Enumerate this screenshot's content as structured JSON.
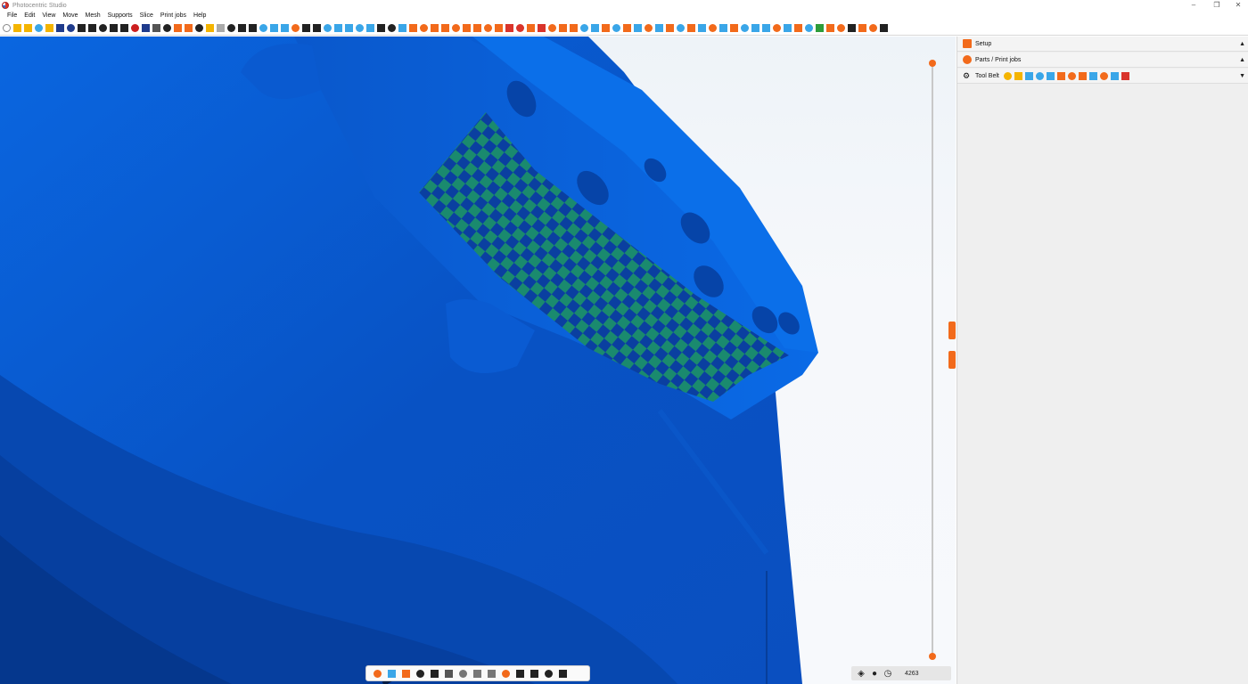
{
  "window": {
    "title": "Photocentric Studio",
    "controls": [
      "–",
      "❐",
      "✕"
    ]
  },
  "menu": [
    "File",
    "Edit",
    "View",
    "Move",
    "Mesh",
    "Supports",
    "Slice",
    "Print jobs",
    "Help"
  ],
  "toolbar": {
    "icons": [
      {
        "name": "new-file-icon",
        "color": "#ffffff"
      },
      {
        "name": "open-folder-icon",
        "color": "#f4b400"
      },
      {
        "name": "add-part-icon",
        "color": "#f4b400"
      },
      {
        "name": "import-icon",
        "color": "#3aa6e8"
      },
      {
        "name": "folder-icon",
        "color": "#f4b400"
      },
      {
        "name": "save-icon",
        "color": "#1f3b8c"
      },
      {
        "name": "save-all-icon",
        "color": "#1f3b8c"
      },
      {
        "name": "printer-icon",
        "color": "#222222"
      },
      {
        "name": "settings-icon",
        "color": "#222222"
      },
      {
        "name": "export-icon",
        "color": "#222222"
      },
      {
        "name": "share-icon",
        "color": "#222222"
      },
      {
        "name": "key-icon",
        "color": "#222222"
      },
      {
        "name": "delete-icon",
        "color": "#cc1f1f"
      },
      {
        "name": "undo-icon",
        "color": "#1f3b8c"
      },
      {
        "name": "redo-icon",
        "color": "#555555"
      },
      {
        "name": "copy-icon",
        "color": "#222222"
      },
      {
        "name": "paste-icon",
        "color": "#f26a1b"
      },
      {
        "name": "basket-icon",
        "color": "#f26a1b"
      },
      {
        "name": "trash-icon",
        "color": "#222222"
      },
      {
        "name": "select-all-icon",
        "color": "#f4b400"
      },
      {
        "name": "select-icon",
        "color": "#aaaaaa"
      },
      {
        "name": "info-icon",
        "color": "#222222"
      },
      {
        "name": "zoom-icon",
        "color": "#222222"
      },
      {
        "name": "pen-icon",
        "color": "#222222"
      },
      {
        "name": "rotate-x-icon",
        "color": "#3aa6e8"
      },
      {
        "name": "rotate-y-icon",
        "color": "#3aa6e8"
      },
      {
        "name": "rotate-z-icon",
        "color": "#3aa6e8"
      },
      {
        "name": "scale-icon",
        "color": "#f26a1b"
      },
      {
        "name": "frame-icon",
        "color": "#222222"
      },
      {
        "name": "line-icon",
        "color": "#222222"
      },
      {
        "name": "measure-icon",
        "color": "#3aa6e8"
      },
      {
        "name": "arrange-icon",
        "color": "#3aa6e8"
      },
      {
        "name": "snowflake-icon",
        "color": "#3aa6e8"
      },
      {
        "name": "mirror-icon",
        "color": "#3aa6e8"
      },
      {
        "name": "grid-icon",
        "color": "#3aa6e8"
      },
      {
        "name": "hollow-icon",
        "color": "#222222"
      },
      {
        "name": "split-icon",
        "color": "#222222"
      },
      {
        "name": "cube-icon",
        "color": "#3aa6e8"
      },
      {
        "name": "links-icon",
        "color": "#f26a1b"
      },
      {
        "name": "bolt-icon",
        "color": "#f26a1b"
      },
      {
        "name": "ring-icon",
        "color": "#f26a1b"
      },
      {
        "name": "target-icon",
        "color": "#f26a1b"
      },
      {
        "name": "gear-orange-icon",
        "color": "#f26a1b"
      },
      {
        "name": "donut-icon",
        "color": "#f26a1b"
      },
      {
        "name": "cup-icon",
        "color": "#f26a1b"
      },
      {
        "name": "globe-icon",
        "color": "#f26a1b"
      },
      {
        "name": "sphere-icon",
        "color": "#f26a1b"
      },
      {
        "name": "support-icon",
        "color": "#d9342b"
      },
      {
        "name": "cubes-icon",
        "color": "#d9342b"
      },
      {
        "name": "paint-icon",
        "color": "#f26a1b"
      },
      {
        "name": "grid-support-icon",
        "color": "#d9342b"
      },
      {
        "name": "drop-icon",
        "color": "#f26a1b"
      },
      {
        "name": "base-icon",
        "color": "#f26a1b"
      },
      {
        "name": "text-icon",
        "color": "#f26a1b"
      },
      {
        "name": "slice-a-icon",
        "color": "#3aa6e8"
      },
      {
        "name": "slice-b-icon",
        "color": "#3aa6e8"
      },
      {
        "name": "slice-c-icon",
        "color": "#f26a1b"
      },
      {
        "name": "slice-d-icon",
        "color": "#3aa6e8"
      },
      {
        "name": "slice-e-icon",
        "color": "#f26a1b"
      },
      {
        "name": "slice-f-icon",
        "color": "#3aa6e8"
      },
      {
        "name": "slice-g-icon",
        "color": "#f26a1b"
      },
      {
        "name": "slice-h-icon",
        "color": "#3aa6e8"
      },
      {
        "name": "slice-i-icon",
        "color": "#f26a1b"
      },
      {
        "name": "slice-j-icon",
        "color": "#3aa6e8"
      },
      {
        "name": "slice-k-icon",
        "color": "#f26a1b"
      },
      {
        "name": "slice-l-icon",
        "color": "#3aa6e8"
      },
      {
        "name": "slice-m-icon",
        "color": "#f26a1b"
      },
      {
        "name": "slice-n-icon",
        "color": "#3aa6e8"
      },
      {
        "name": "drop2-icon",
        "color": "#f26a1b"
      },
      {
        "name": "cloud-icon",
        "color": "#3aa6e8"
      },
      {
        "name": "bridge-icon",
        "color": "#3aa6e8"
      },
      {
        "name": "arch-icon",
        "color": "#3aa6e8"
      },
      {
        "name": "brush-icon",
        "color": "#f26a1b"
      },
      {
        "name": "tree-icon",
        "color": "#3aa6e8"
      },
      {
        "name": "branch-icon",
        "color": "#f26a1b"
      },
      {
        "name": "plant-icon",
        "color": "#3aa6e8"
      },
      {
        "name": "leaf-icon",
        "color": "#2e9c3a"
      },
      {
        "name": "print-icon",
        "color": "#f26a1b"
      },
      {
        "name": "flag-icon",
        "color": "#f26a1b"
      },
      {
        "name": "http-icon",
        "color": "#222222"
      },
      {
        "name": "link-out-icon",
        "color": "#f26a1b"
      },
      {
        "name": "external-icon",
        "color": "#f26a1b"
      },
      {
        "name": "upload-icon",
        "color": "#222222"
      }
    ]
  },
  "viewport": {
    "colors": {
      "model": "#0a5fd6",
      "model_dark": "#003c9c",
      "checker_a": "#1a8a6e",
      "checker_b": "#0a3fa0"
    }
  },
  "bottom_toolbar": {
    "icons": [
      {
        "name": "box-icon",
        "color": "#f26a1b"
      },
      {
        "name": "funnel-icon",
        "color": "#3aa6e8"
      },
      {
        "name": "circle-icon",
        "color": "#f26a1b"
      },
      {
        "name": "grid-view-icon",
        "color": "#222222"
      },
      {
        "name": "disk-icon",
        "color": "#222222"
      },
      {
        "name": "contrast-icon",
        "color": "#555555"
      },
      {
        "name": "bowl-icon",
        "color": "#777777"
      },
      {
        "name": "minus-icon",
        "color": "#777777"
      },
      {
        "name": "drop-down-icon",
        "color": "#777777"
      },
      {
        "name": "palette-icon",
        "color": "#f26a1b"
      },
      {
        "name": "ruler-icon",
        "color": "#222222"
      },
      {
        "name": "checker-icon",
        "color": "#222222"
      },
      {
        "name": "table-icon",
        "color": "#222222"
      },
      {
        "name": "swap-icon",
        "color": "#222222"
      }
    ]
  },
  "status": {
    "layers_icon": "layers-icon",
    "drop_icon": "resin-icon",
    "clock_icon": "clock-icon",
    "layer_count": "4263"
  },
  "right_panel": {
    "setup": {
      "label": "Setup",
      "caret": "▲"
    },
    "parts": {
      "label": "Parts / Print jobs",
      "caret": "▲"
    },
    "toolbelt": {
      "label": "Tool Belt",
      "caret": "▼",
      "icons": [
        {
          "name": "clock-tool-icon",
          "color": "#f4b400"
        },
        {
          "name": "folder-tool-icon",
          "color": "#f4b400"
        },
        {
          "name": "layout-tool-icon",
          "color": "#3aa6e8"
        },
        {
          "name": "arch-tool-icon",
          "color": "#3aa6e8"
        },
        {
          "name": "text-tool-icon",
          "color": "#3aa6e8"
        },
        {
          "name": "ring-tool-icon",
          "color": "#f26a1b"
        },
        {
          "name": "gear-tool-icon",
          "color": "#f26a1b"
        },
        {
          "name": "cup-tool-icon",
          "color": "#f26a1b"
        },
        {
          "name": "chart-tool-icon",
          "color": "#3aa6e8"
        },
        {
          "name": "measure-tool-icon",
          "color": "#f26a1b"
        },
        {
          "name": "grid-tool-icon",
          "color": "#3aa6e8"
        },
        {
          "name": "flag-tool-icon",
          "color": "#d9342b"
        }
      ]
    }
  }
}
